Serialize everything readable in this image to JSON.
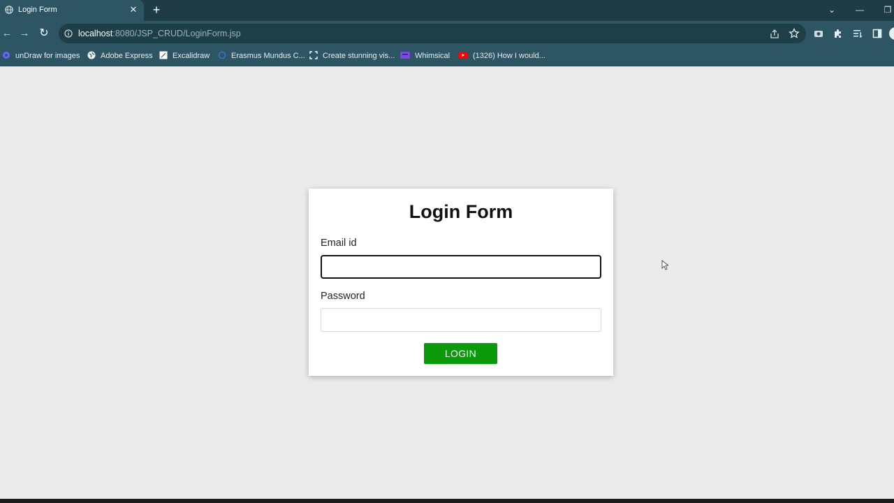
{
  "browser": {
    "tab": {
      "title": "Login Form",
      "close": "✕",
      "favicon": "globe-icon"
    },
    "new_tab": "+",
    "window_controls": {
      "dropdown": "⌄",
      "minimize": "—",
      "restore": "❐"
    },
    "address_bar": {
      "host": "localhost",
      "path": ":8080/JSP_CRUD/LoginForm.jsp"
    },
    "nav": {
      "back": "←",
      "forward": "→",
      "reload": "↻"
    },
    "toolbar_icons": [
      "share-icon",
      "star-icon",
      "camera-icon",
      "extensions-icon",
      "reading-list-icon",
      "side-panel-icon",
      "profile-icon"
    ],
    "bookmarks": [
      {
        "label": "unDraw for images",
        "icon": "undraw-icon",
        "color": "#6c63ff"
      },
      {
        "label": "Adobe Express",
        "icon": "globe-icon",
        "color": "#ffffff"
      },
      {
        "label": "Excalidraw",
        "icon": "excalidraw-icon",
        "color": "#ffffff"
      },
      {
        "label": "Erasmus Mundus C...",
        "icon": "erasmus-icon",
        "color": "#3b6fd8"
      },
      {
        "label": "Create stunning vis...",
        "icon": "canva-icon",
        "color": "#ffffff"
      },
      {
        "label": "Whimsical",
        "icon": "whimsical-icon",
        "color": "#7b4ae2"
      },
      {
        "label": "(1326) How I would...",
        "icon": "youtube-icon",
        "color": "#ff0000"
      }
    ]
  },
  "login": {
    "title": "Login Form",
    "email_label": "Email id",
    "email_value": "",
    "password_label": "Password",
    "password_value": "",
    "button_label": "LOGIN",
    "button_color": "#0a9a0a"
  }
}
